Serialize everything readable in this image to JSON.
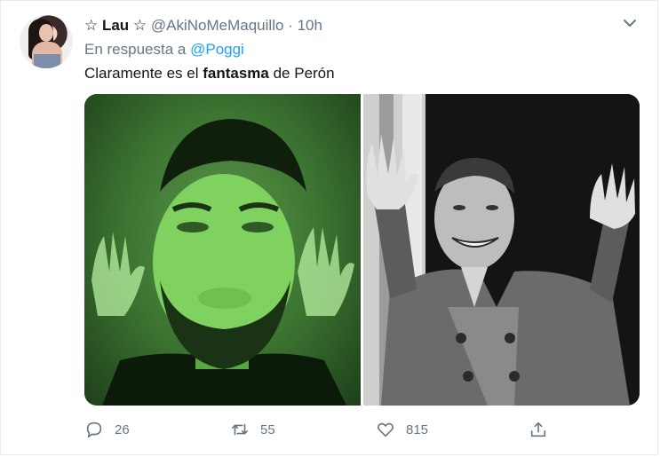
{
  "author": {
    "name": "☆ Lau ☆",
    "handle": "@AkiNoMeMaquillo",
    "separator": "·",
    "time": "10h"
  },
  "reply_line": {
    "prefix": "En respuesta a",
    "mention": "@Poggi"
  },
  "tweet_text": {
    "before": "Claramente es el ",
    "bold": "fantasma",
    "after": " de Perón"
  },
  "actions": {
    "reply_count": "26",
    "retweet_count": "55",
    "like_count": "815"
  },
  "icons": {
    "menu": "chevron-down-icon",
    "reply": "reply-icon",
    "retweet": "retweet-icon",
    "like": "heart-icon",
    "share": "share-icon"
  },
  "colors": {
    "text": "#14171a",
    "muted": "#657786",
    "link": "#1da1f2",
    "border": "#e6ecf0"
  }
}
